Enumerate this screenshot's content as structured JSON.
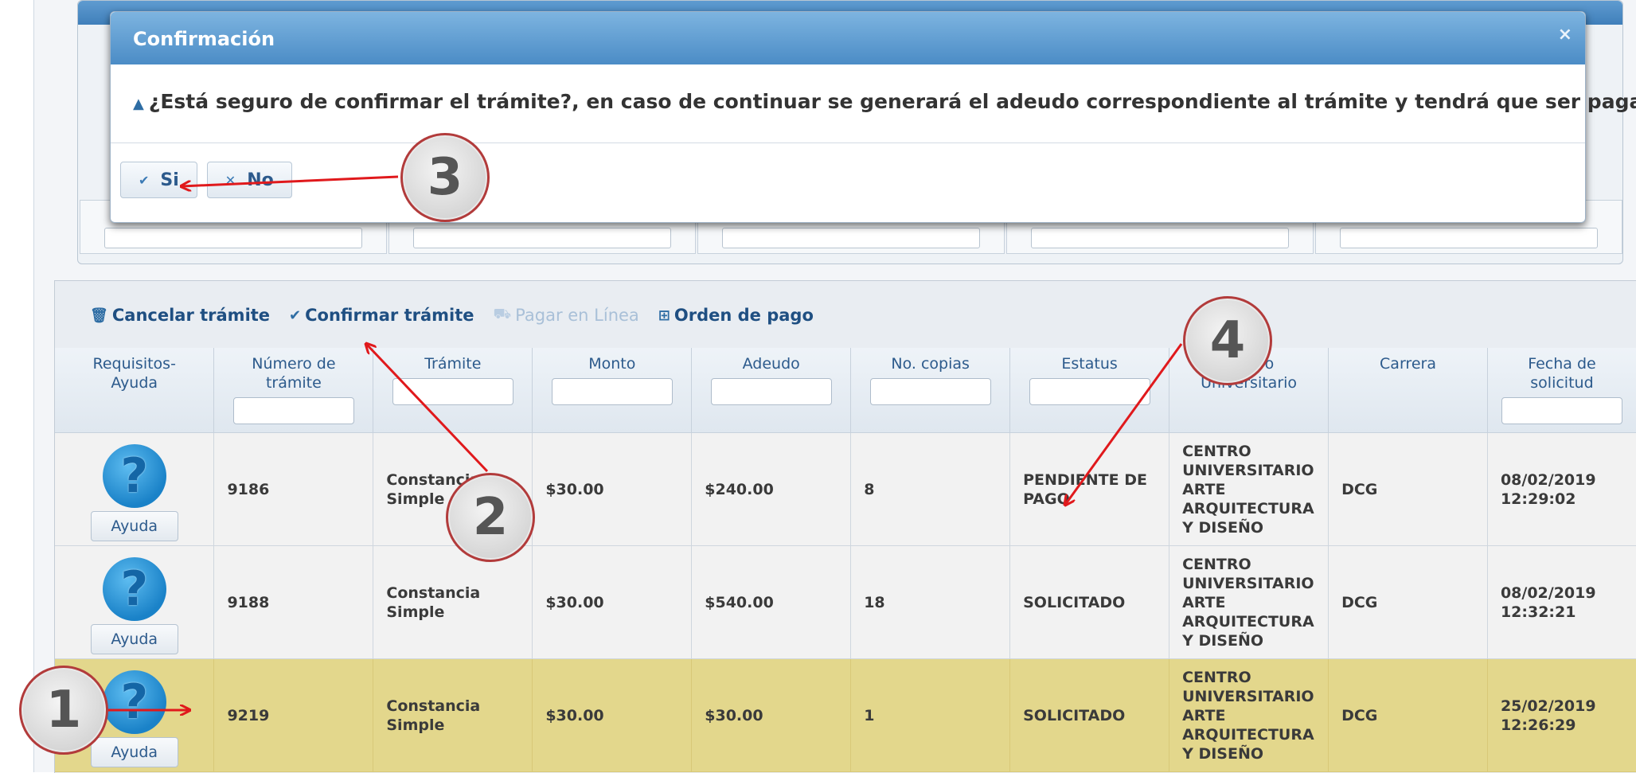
{
  "dialog": {
    "title": "Confirmación",
    "close_glyph": "×",
    "message": "¿Está seguro de confirmar el trámite?, en caso de continuar se generará el adeudo correspondiente al trámite y tendrá que ser pagado.",
    "warning_icon": "warning-icon",
    "yes_label": "Si",
    "yes_icon": "check-icon",
    "no_label": "No",
    "no_icon": "x-icon"
  },
  "toolbar": {
    "cancel_label": "Cancelar trámite",
    "confirm_label": "Confirmar trámite",
    "pay_online_label": "Pagar en Línea",
    "payment_order_label": "Orden de pago"
  },
  "grid": {
    "columns": [
      {
        "label": "Requisitos-\nAyuda"
      },
      {
        "label": "Número de\ntrámite"
      },
      {
        "label": "Trámite"
      },
      {
        "label": "Monto"
      },
      {
        "label": "Adeudo"
      },
      {
        "label": "No. copias"
      },
      {
        "label": "Estatus"
      },
      {
        "label": "Centro\nUniversitario"
      },
      {
        "label": "Carrera"
      },
      {
        "label": "Fecha de\nsolicitud"
      }
    ],
    "help_label": "Ayuda",
    "rows": [
      {
        "numero": "9186",
        "tramite": "Constancia\nSimple",
        "monto": "$30.00",
        "adeudo": "$240.00",
        "copias": "8",
        "estatus": "PENDIENTE DE\nPAGO",
        "centro": "CENTRO\nUNIVERSITARIO\nARTE\nARQUITECTURA\nY DISEÑO",
        "carrera": "DCG",
        "fecha": "08/02/2019\n12:29:02"
      },
      {
        "numero": "9188",
        "tramite": "Constancia\nSimple",
        "monto": "$30.00",
        "adeudo": "$540.00",
        "copias": "18",
        "estatus": "SOLICITADO",
        "centro": "CENTRO\nUNIVERSITARIO\nARTE\nARQUITECTURA\nY DISEÑO",
        "carrera": "DCG",
        "fecha": "08/02/2019\n12:32:21"
      },
      {
        "numero": "9219",
        "tramite": "Constancia\nSimple",
        "monto": "$30.00",
        "adeudo": "$30.00",
        "copias": "1",
        "estatus": "SOLICITADO",
        "centro": "CENTRO\nUNIVERSITARIO\nARTE\nARQUITECTURA\nY DISEÑO",
        "carrera": "DCG",
        "fecha": "25/02/2019\n12:26:29"
      }
    ]
  },
  "annotations": {
    "step1": "1",
    "step2": "2",
    "step3": "3",
    "step4": "4",
    "arrow_color": "#e0191c"
  }
}
